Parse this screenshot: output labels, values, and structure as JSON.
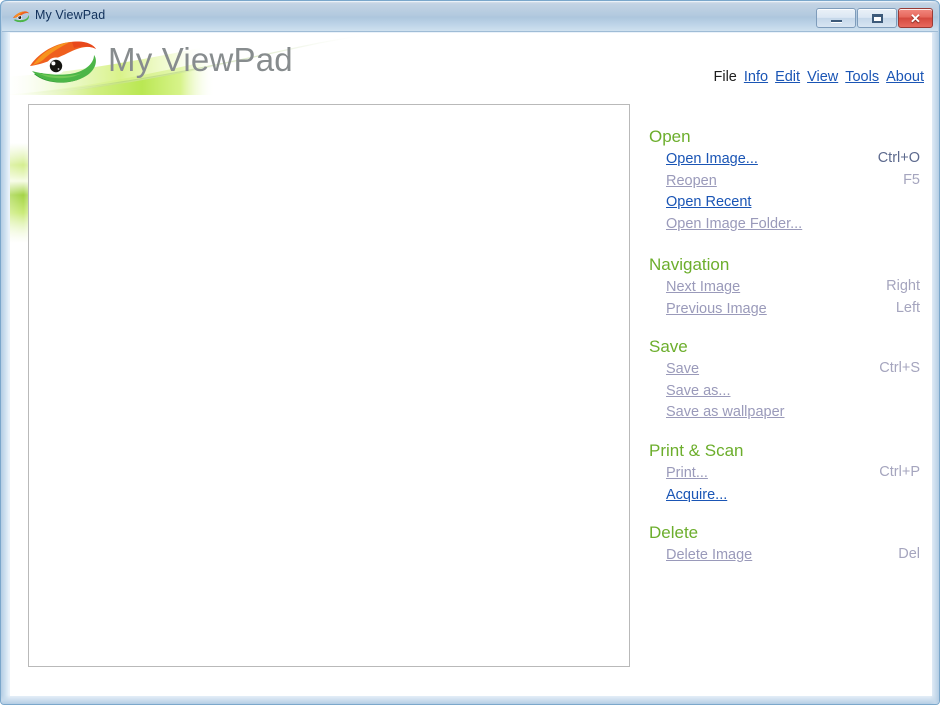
{
  "window": {
    "title": "My ViewPad",
    "icon": "app-logo-icon",
    "controls": {
      "minimize": "–",
      "maximize": "□",
      "close": "✕"
    }
  },
  "header": {
    "app_name": "My ViewPad",
    "logo": "viewpad-eye-logo"
  },
  "image_panel": {
    "content": ""
  },
  "menu": {
    "tabs": [
      {
        "label": "File",
        "active": true
      },
      {
        "label": "Info",
        "active": false
      },
      {
        "label": "Edit",
        "active": false
      },
      {
        "label": "View",
        "active": false
      },
      {
        "label": "Tools",
        "active": false
      },
      {
        "label": "About",
        "active": false
      }
    ],
    "sections": [
      {
        "title": "Open",
        "items": [
          {
            "label": "Open Image...",
            "shortcut": "Ctrl+O",
            "enabled": true
          },
          {
            "label": "Reopen",
            "shortcut": "F5",
            "enabled": false
          },
          {
            "label": "Open Recent",
            "shortcut": "",
            "enabled": true
          },
          {
            "label": "Open Image Folder...",
            "shortcut": "",
            "enabled": false
          }
        ]
      },
      {
        "title": "Navigation",
        "items": [
          {
            "label": "Next Image",
            "shortcut": "Right",
            "enabled": false
          },
          {
            "label": "Previous Image",
            "shortcut": "Left",
            "enabled": false
          }
        ]
      },
      {
        "title": "Save",
        "items": [
          {
            "label": "Save",
            "shortcut": "Ctrl+S",
            "enabled": false
          },
          {
            "label": "Save as...",
            "shortcut": "",
            "enabled": false
          },
          {
            "label": "Save as wallpaper",
            "shortcut": "",
            "enabled": false
          }
        ]
      },
      {
        "title": "Print & Scan",
        "items": [
          {
            "label": "Print...",
            "shortcut": "Ctrl+P",
            "enabled": false
          },
          {
            "label": "Acquire...",
            "shortcut": "",
            "enabled": true
          }
        ]
      },
      {
        "title": "Delete",
        "items": [
          {
            "label": "Delete Image",
            "shortcut": "Del",
            "enabled": false
          }
        ]
      }
    ]
  },
  "colors": {
    "section_heading": "#6cae2c",
    "link_enabled": "#1a55b5",
    "link_disabled": "#9a9aba",
    "shortcut_enabled": "#5d6a8e",
    "shortcut_disabled": "#a5a5be",
    "app_title": "#878c8e",
    "titlebar_text": "#10305a",
    "logo_orange": "#f05a23",
    "logo_green": "#3fa535",
    "swoosh_green": "#b6e04a"
  }
}
